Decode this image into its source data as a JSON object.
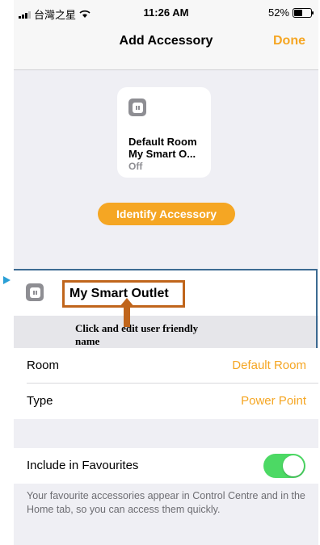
{
  "status_bar": {
    "carrier": "台灣之星",
    "time": "11:26 AM",
    "battery": "52%",
    "battery_level": 0.52
  },
  "nav": {
    "title": "Add Accessory",
    "done_label": "Done"
  },
  "tile": {
    "room": "Default Room",
    "name": "My Smart O...",
    "state": "Off"
  },
  "identify_label": "Identify Accessory",
  "name_field": {
    "value": "My Smart Outlet"
  },
  "annotation": {
    "text": "Click and edit user friendly name"
  },
  "rows": {
    "room": {
      "label": "Room",
      "value": "Default Room"
    },
    "type": {
      "label": "Type",
      "value": "Power Point"
    }
  },
  "favourites": {
    "label": "Include in Favourites",
    "enabled": true,
    "note": "Your favourite accessories appear in Control Centre and in the Home tab, so you can access them quickly."
  },
  "colors": {
    "accent": "#f5a623",
    "toggle_on": "#4cd964",
    "annotation": "#c0651b",
    "highlight": "#3d6b92"
  }
}
